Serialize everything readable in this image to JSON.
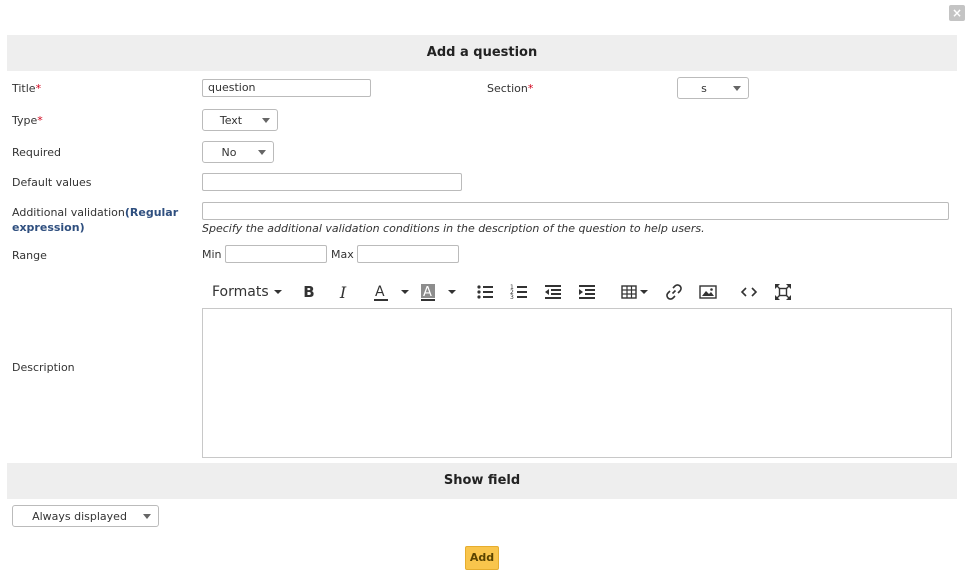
{
  "dialog": {
    "title": "Add a question",
    "close_label": "×"
  },
  "form": {
    "title": {
      "label": "Title",
      "required_mark": "*",
      "value": "question"
    },
    "section": {
      "label": "Section",
      "required_mark": "*",
      "value": "s"
    },
    "type": {
      "label": "Type",
      "required_mark": "*",
      "value": "Text"
    },
    "required": {
      "label": "Required",
      "value": "No"
    },
    "default_values": {
      "label": "Default values",
      "value": ""
    },
    "additional_validation": {
      "label": "Additional validation",
      "label_highlight": "(Regular expression)",
      "value": "",
      "hint": "Specify the additional validation conditions in the description of the question to help users."
    },
    "range": {
      "label": "Range",
      "min_label": "Min",
      "max_label": "Max",
      "min_value": "",
      "max_value": ""
    },
    "description": {
      "label": "Description"
    }
  },
  "editor_toolbar": {
    "formats_label": "Formats",
    "icons": [
      "caret-down-icon",
      "bold-icon",
      "italic-icon",
      "text-color-icon",
      "caret-down-icon",
      "background-color-icon",
      "caret-down-icon",
      "bullet-list-icon",
      "numbered-list-icon",
      "outdent-icon",
      "indent-icon",
      "table-icon",
      "caret-down-icon",
      "link-icon",
      "image-icon",
      "source-code-icon",
      "fullscreen-icon"
    ]
  },
  "show_field": {
    "title": "Show field",
    "value": "Always displayed"
  },
  "actions": {
    "add_label": "Add"
  },
  "colors": {
    "header_bg": "#eeeeee",
    "required": "#d0021b",
    "regex_label": "#2f4f7f",
    "add_button": "#f9c54c"
  }
}
